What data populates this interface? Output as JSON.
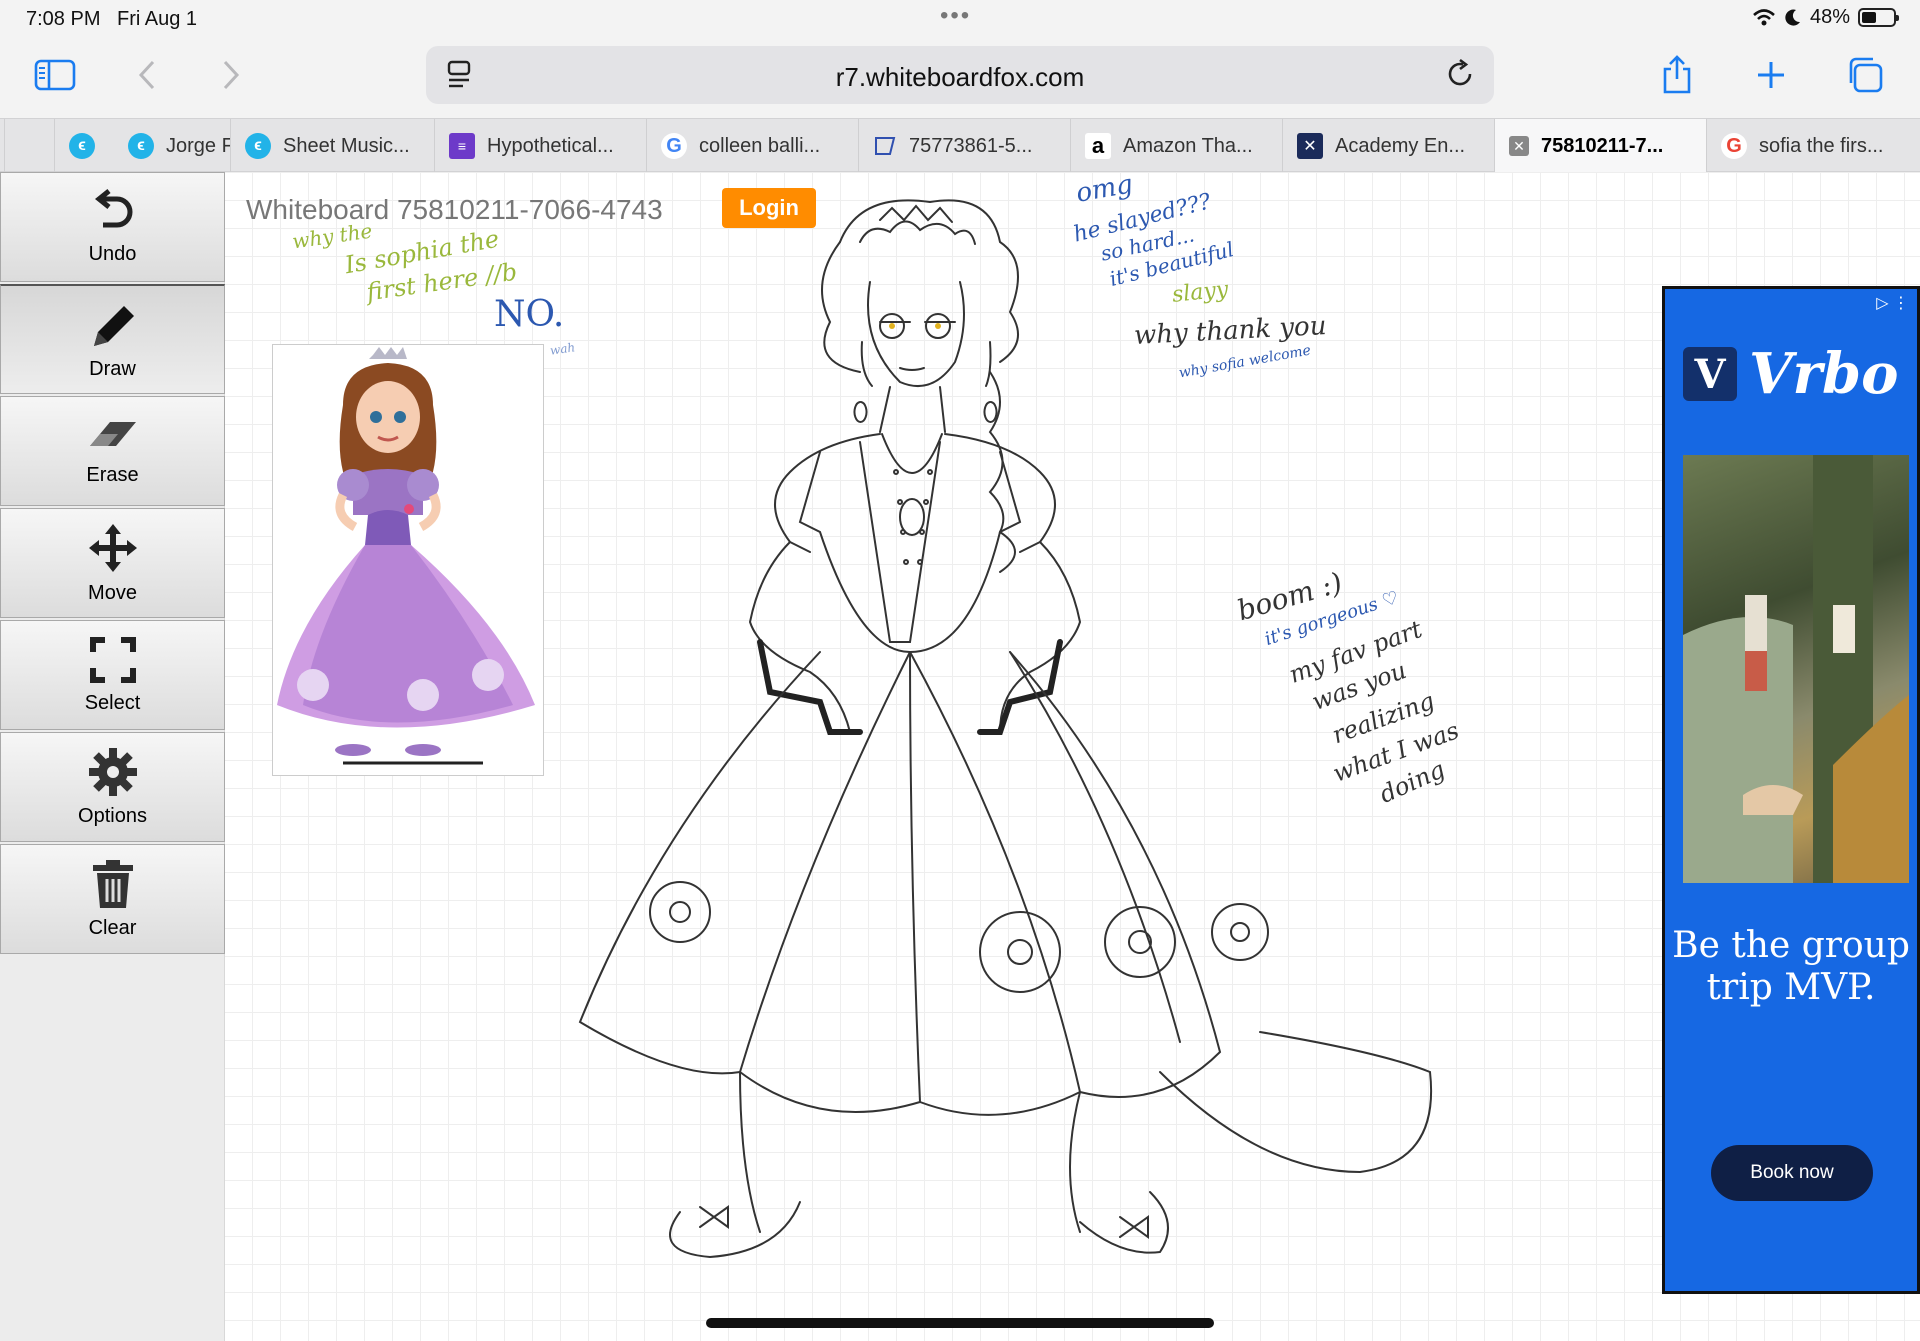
{
  "status": {
    "time": "7:08 PM",
    "date": "Fri Aug 1",
    "battery": "48%",
    "battery_level": 0.48
  },
  "browser": {
    "url": "r7.whiteboardfox.com",
    "tabs": [
      {
        "label": "",
        "favicon": "whiteboardfox-icon"
      },
      {
        "label": "Jorge F",
        "favicon": "whiteboardfox-icon"
      },
      {
        "label": "Sheet Music...",
        "favicon": "whiteboardfox-icon"
      },
      {
        "label": "Hypothetical...",
        "favicon": "forms-icon"
      },
      {
        "label": "colleen balli...",
        "favicon": "google-icon"
      },
      {
        "label": "75773861-5...",
        "favicon": "whiteboard-icon"
      },
      {
        "label": "Amazon Tha...",
        "favicon": "amazon-icon"
      },
      {
        "label": "Academy En...",
        "favicon": "academy-icon"
      },
      {
        "label": "75810211-7...",
        "favicon": "close-icon",
        "active": true
      },
      {
        "label": "sofia the firs...",
        "favicon": "google-icon"
      }
    ]
  },
  "tools": [
    {
      "label": "Undo",
      "icon": "undo-icon"
    },
    {
      "label": "Draw",
      "icon": "pencil-icon",
      "active": true
    },
    {
      "label": "Erase",
      "icon": "eraser-icon"
    },
    {
      "label": "Move",
      "icon": "move-icon"
    },
    {
      "label": "Select",
      "icon": "select-icon"
    },
    {
      "label": "Options",
      "icon": "gear-icon"
    },
    {
      "label": "Clear",
      "icon": "trash-icon"
    }
  ],
  "whiteboard": {
    "title": "Whiteboard 75810211-7066-4743",
    "login_label": "Login",
    "notes": {
      "n1": "why the",
      "n2": "Is sophia the",
      "n3": "first here //b",
      "n4": "NO.",
      "n5": "omg",
      "n6": "he slayed???",
      "n7": "so hard...",
      "n8": "it's beautiful",
      "n9": "slayy",
      "n10": "why thank you",
      "n11": "why sofia welcome",
      "n12": "boom :)",
      "n13": "it's gorgeous ♡",
      "n14": "my fav part",
      "n15": "was you",
      "n16": "realizing",
      "n17": "what I was",
      "n18": "doing",
      "n19": "wah"
    }
  },
  "ad": {
    "brand": "Vrbo",
    "brand_letter": "V",
    "headline": "Be the group trip MVP.",
    "button": "Book now",
    "brand_color": "#1668e3"
  }
}
